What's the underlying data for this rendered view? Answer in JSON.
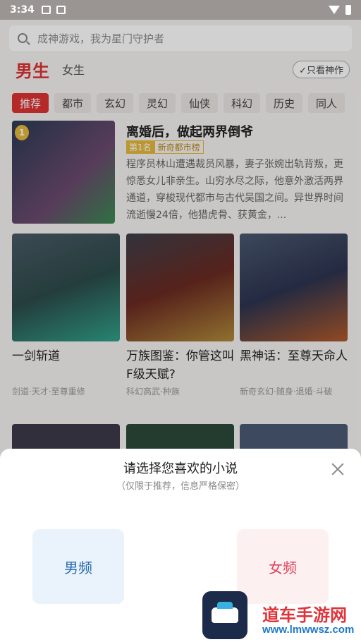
{
  "status": {
    "time": "3:34"
  },
  "search": {
    "placeholder": "成神游戏，我为星门守护者"
  },
  "gender": {
    "male": "男生",
    "female": "女生",
    "only_godworks": "只看神作"
  },
  "tabs": [
    "推荐",
    "都市",
    "玄幻",
    "灵幻",
    "仙侠",
    "科幻",
    "历史",
    "同人"
  ],
  "feature": {
    "rank": "1",
    "title": "离婚后，做起两界倒爷",
    "badge_rank": "第1名",
    "badge_list": "新奇都市榜",
    "desc": "程序员林山遭遇裁员风暴，妻子张婉出轨背叛，更惊悉女儿非亲生。山穷水尽之际，他意外激活两界通道，穿梭现代都市与古代吴国之间。异世界时间流逝慢24倍，他猎虎骨、获黄金，..."
  },
  "grid": [
    {
      "name": "一剑斩道",
      "tags": "剑道·天才·至尊重修"
    },
    {
      "name": "万族图鉴：你管这叫F级天赋?",
      "tags": "科幻高武·种族"
    },
    {
      "name": "黑神话：至尊天命人",
      "tags": "新奇玄幻·随身·退婚·斗破"
    }
  ],
  "sheet": {
    "title": "请选择您喜欢的小说",
    "subtitle": "（仅限于推荐，信息严格保密）",
    "male": "男频",
    "female": "女频"
  },
  "watermark": {
    "name": "道车手游网",
    "url": "www.lmwwsz.com"
  }
}
